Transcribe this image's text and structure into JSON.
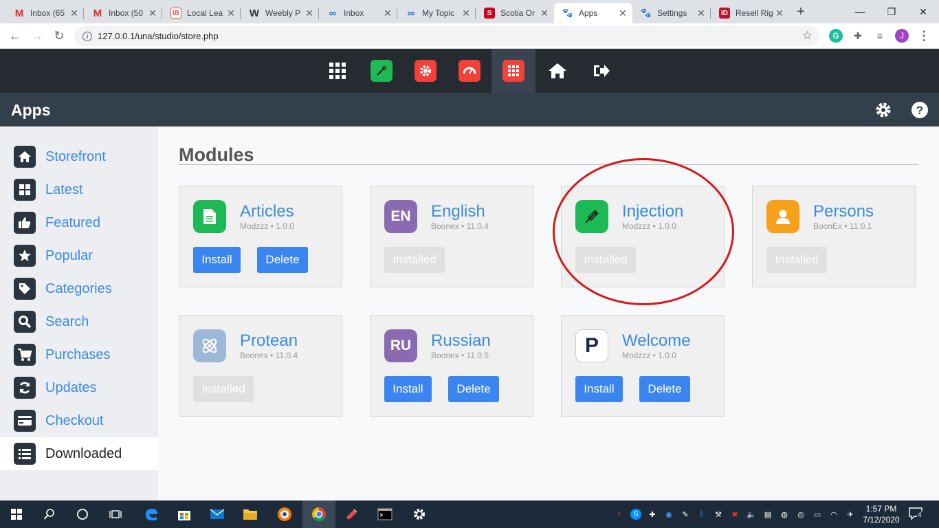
{
  "browser": {
    "tabs": [
      {
        "label": "Inbox (65",
        "icon": "gmail-icon"
      },
      {
        "label": "Inbox (50",
        "icon": "gmail-icon"
      },
      {
        "label": "Local Lea",
        "icon": "ib-icon"
      },
      {
        "label": "Weebly P",
        "icon": "weebly-icon"
      },
      {
        "label": "Inbox",
        "icon": "infinity-icon"
      },
      {
        "label": "My Topic",
        "icon": "infinity-icon"
      },
      {
        "label": "Scotia Or",
        "icon": "scotia-icon"
      },
      {
        "label": "Apps",
        "icon": "paw-icon"
      },
      {
        "label": "Settings",
        "icon": "paw-icon"
      },
      {
        "label": "Resell Rig",
        "icon": "id-icon"
      }
    ],
    "active_tab": "Apps",
    "url": "127.0.0.1/una/studio/store.php",
    "profile_initial": "J"
  },
  "page": {
    "title": "Apps"
  },
  "sidebar": {
    "items": [
      {
        "label": "Storefront",
        "icon": "home-icon"
      },
      {
        "label": "Latest",
        "icon": "grid-icon"
      },
      {
        "label": "Featured",
        "icon": "thumbs-up-icon"
      },
      {
        "label": "Popular",
        "icon": "star-icon"
      },
      {
        "label": "Categories",
        "icon": "tag-icon"
      },
      {
        "label": "Search",
        "icon": "search-icon"
      },
      {
        "label": "Purchases",
        "icon": "cart-icon"
      },
      {
        "label": "Updates",
        "icon": "refresh-icon"
      },
      {
        "label": "Checkout",
        "icon": "credit-card-icon"
      },
      {
        "label": "Downloaded",
        "icon": "list-icon"
      }
    ],
    "active": "Downloaded"
  },
  "main": {
    "section_title": "Modules",
    "modules": [
      {
        "name": "Articles",
        "meta": "Modzzz • 1.0.0",
        "icon_text": "",
        "icon": "document-icon",
        "color": "#1db954",
        "install_label": "Install",
        "delete_label": "Delete"
      },
      {
        "name": "English",
        "meta": "Boonex • 11.0.4",
        "icon_text": "EN",
        "icon": "language-icon",
        "color": "#8a6bb1",
        "installed_label": "Installed"
      },
      {
        "name": "Injection",
        "meta": "Modzzz • 1.0.0",
        "icon_text": "",
        "icon": "syringe-icon",
        "color": "#1db954",
        "installed_label": "Installed"
      },
      {
        "name": "Persons",
        "meta": "BoonEx • 11.0.1",
        "icon_text": "",
        "icon": "person-icon",
        "color": "#f7a11a",
        "installed_label": "Installed"
      },
      {
        "name": "Protean",
        "meta": "Boonex • 11.0.4",
        "icon_text": "",
        "icon": "atom-icon",
        "color": "#9db7d8",
        "installed_label": "Installed"
      },
      {
        "name": "Russian",
        "meta": "Boonex • 11.0.5",
        "icon_text": "RU",
        "icon": "language-icon",
        "color": "#8a6bb1",
        "install_label": "Install",
        "delete_label": "Delete"
      },
      {
        "name": "Welcome",
        "meta": "Modzzz • 1.0.0",
        "icon_text": "P",
        "icon": "welcome-p-icon",
        "color": "#ffffff",
        "install_label": "Install",
        "delete_label": "Delete"
      }
    ]
  },
  "taskbar": {
    "time": "1:57 PM",
    "date": "7/12/2020",
    "notifications": "4"
  },
  "colors": {
    "accent": "#3a85f0",
    "link": "#3a8be0",
    "topnav": "#262b31",
    "header": "#343f4c",
    "annotation_circle": "#d7191c"
  }
}
